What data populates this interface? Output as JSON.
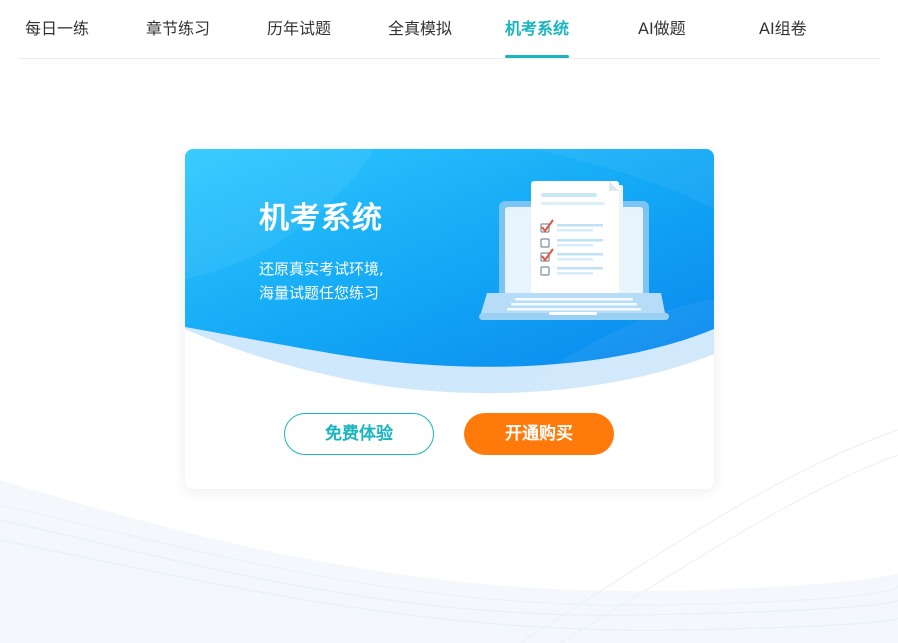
{
  "tabs": [
    {
      "label": "每日一练",
      "active": false
    },
    {
      "label": "章节练习",
      "active": false
    },
    {
      "label": "历年试题",
      "active": false
    },
    {
      "label": "全真模拟",
      "active": false
    },
    {
      "label": "机考系统",
      "active": true
    },
    {
      "label": "AI做题",
      "active": false
    },
    {
      "label": "AI组卷",
      "active": false
    }
  ],
  "card": {
    "title": "机考系统",
    "subtitle_line1": "还原真实考试环境,",
    "subtitle_line2": "海量试题任您练习",
    "trial_button": "免费体验",
    "buy_button": "开通购买",
    "illustration_icon": "laptop-exam-checklist-icon"
  },
  "colors": {
    "accent": "#1ab5bd",
    "buy": "#ff7a0a",
    "banner_light": "#30c8ff",
    "banner_dark": "#0a86f0"
  }
}
